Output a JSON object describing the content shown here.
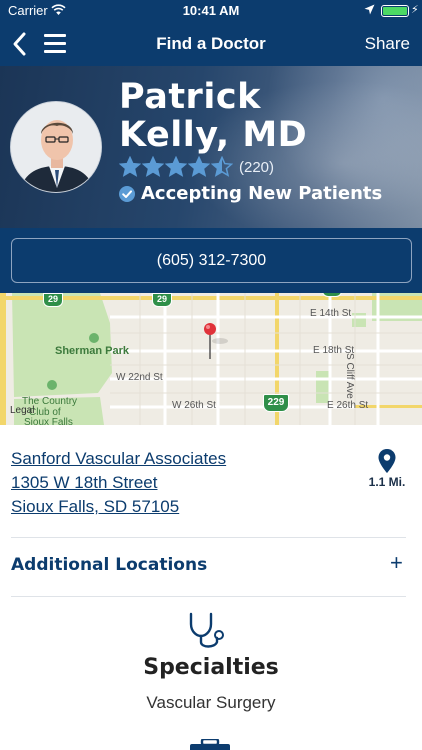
{
  "status_bar": {
    "carrier": "Carrier",
    "time": "10:41 AM"
  },
  "nav": {
    "title": "Find a Doctor",
    "share_label": "Share"
  },
  "doctor": {
    "name_line1": "Patrick",
    "name_line2": "Kelly, MD",
    "rating": 4.5,
    "review_count": "(220)",
    "accepting": "Accepting New Patients",
    "phone": "(605) 312-7300"
  },
  "map": {
    "streets": [
      "E 14th St",
      "E 18th St",
      "W 22nd St",
      "W 26th St",
      "E 26th St",
      "S Cliff Ave"
    ],
    "places": [
      "Sherman Park",
      "The Country",
      "Club of",
      "Sioux Falls"
    ],
    "route_shields": [
      "29",
      "29",
      "229"
    ],
    "legal": "Legal"
  },
  "location": {
    "practice": "Sanford Vascular Associates",
    "street": "1305 W 18th Street",
    "city": "Sioux Falls, SD 57105",
    "distance": "1.1 Mi."
  },
  "additional_locations_label": "Additional Locations",
  "specialties": {
    "title": "Specialties",
    "value": "Vascular Surgery"
  },
  "colors": {
    "brand_navy": "#0c3c6e",
    "star_blue": "#5b9bd5",
    "map_park": "#c9e4b4"
  }
}
